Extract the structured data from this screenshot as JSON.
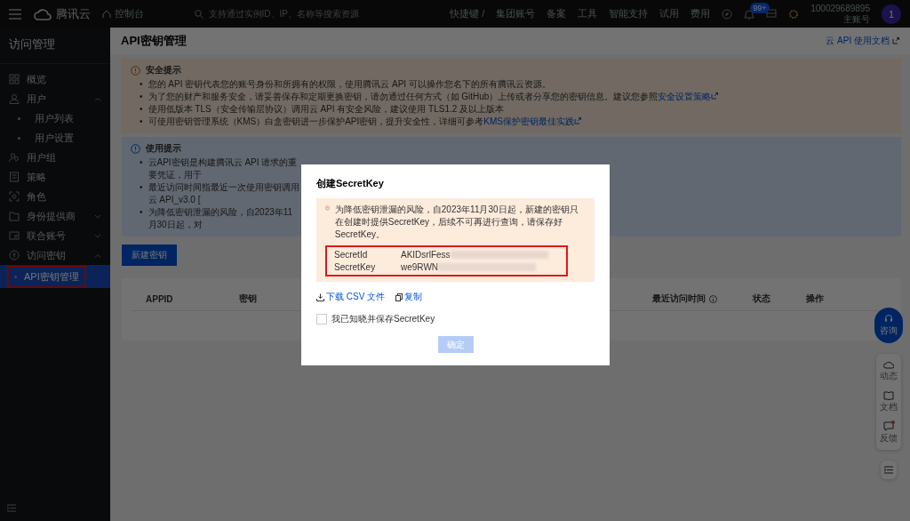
{
  "topbar": {
    "logo": "腾讯云",
    "console": "控制台",
    "search": {
      "placeholder": "支持通过实例ID、IP、名称等搜索资源"
    },
    "shortcut": "快捷键 /",
    "nav": [
      "集团账号",
      "备案",
      "工具",
      "智能支持",
      "试用",
      "费用"
    ],
    "badge": "99+",
    "account_id": "100029689895",
    "account_type": "主账号",
    "avatar": "1"
  },
  "sidebar": {
    "title": "访问管理",
    "items": [
      {
        "label": "概览",
        "selected": false
      },
      {
        "label": "用户",
        "selected": false,
        "expanded": true,
        "children": [
          {
            "label": "用户列表",
            "selected": false
          },
          {
            "label": "用户设置",
            "selected": false
          }
        ]
      },
      {
        "label": "用户组",
        "selected": false
      },
      {
        "label": "策略",
        "selected": false
      },
      {
        "label": "角色",
        "selected": false
      },
      {
        "label": "身份提供商",
        "selected": false,
        "expanded": false
      },
      {
        "label": "联合账号",
        "selected": false,
        "expanded": false
      },
      {
        "label": "访问密钥",
        "selected": false,
        "expanded": true,
        "children": [
          {
            "label": "API密钥管理",
            "selected": true
          }
        ]
      }
    ]
  },
  "page": {
    "title": "API密钥管理",
    "doc_link": "云 API 使用文档",
    "security_alert": {
      "title": "安全提示",
      "bullet": "•",
      "items": [
        {
          "text": "您的 API 密钥代表您的账号身份和所拥有的权限，使用腾讯云 API 可以操作您名下的所有腾讯云资源。"
        },
        {
          "text": "为了您的财产和服务安全，请妥善保存和定期更换密钥，请勿通过任何方式（如 GitHub）上传或者分享您的密钥信息。建议您参照",
          "link": "安全设置策略"
        },
        {
          "text": "使用低版本 TLS（安全传输层协议）调用云 API 有安全风险，建议使用 TLS1.2 及以上版本"
        },
        {
          "text": "可使用密钥管理系统（KMS）白盒密钥进一步保护API密钥，提升安全性，详细可参考",
          "link": "KMS保护密钥最佳实践"
        }
      ]
    },
    "usage_alert": {
      "title": "使用提示",
      "bullet": "•",
      "items": [
        {
          "text": "云API密钥是构建腾讯云 API 请求的重要凭证，用于"
        },
        {
          "text": "最近访问时间指最近一次使用密钥调用云 API_v3.0 ["
        },
        {
          "text": "为降低密钥泄漏的风险，自2023年11月30日起，对"
        }
      ]
    },
    "new_button": "新建密钥",
    "table": {
      "columns": [
        "APPID",
        "密钥",
        "最近访问时间",
        "状态",
        "操作"
      ]
    }
  },
  "float": {
    "consult": "咨询",
    "items": [
      {
        "label": "动态",
        "dot": false
      },
      {
        "label": "文档",
        "dot": false
      },
      {
        "label": "反馈",
        "dot": true
      }
    ]
  },
  "modal": {
    "title": "创建SecretKey",
    "notice": "为降低密钥泄漏的风险，自2023年11月30日起，新建的密钥只在创建时提供SecretKey，后续不可再进行查询，请保存好SecretKey。",
    "secrets": [
      {
        "label": "SecretId",
        "value": "AKIDsrlFess"
      },
      {
        "label": "SecretKey",
        "value": "we9RWN"
      }
    ],
    "download": "下载 CSV 文件",
    "copy": "复制",
    "confirm_check": {
      "label": "我已知晓并保存SecretKey",
      "checked": false
    },
    "confirm": {
      "label": "确定",
      "disabled": true
    }
  }
}
